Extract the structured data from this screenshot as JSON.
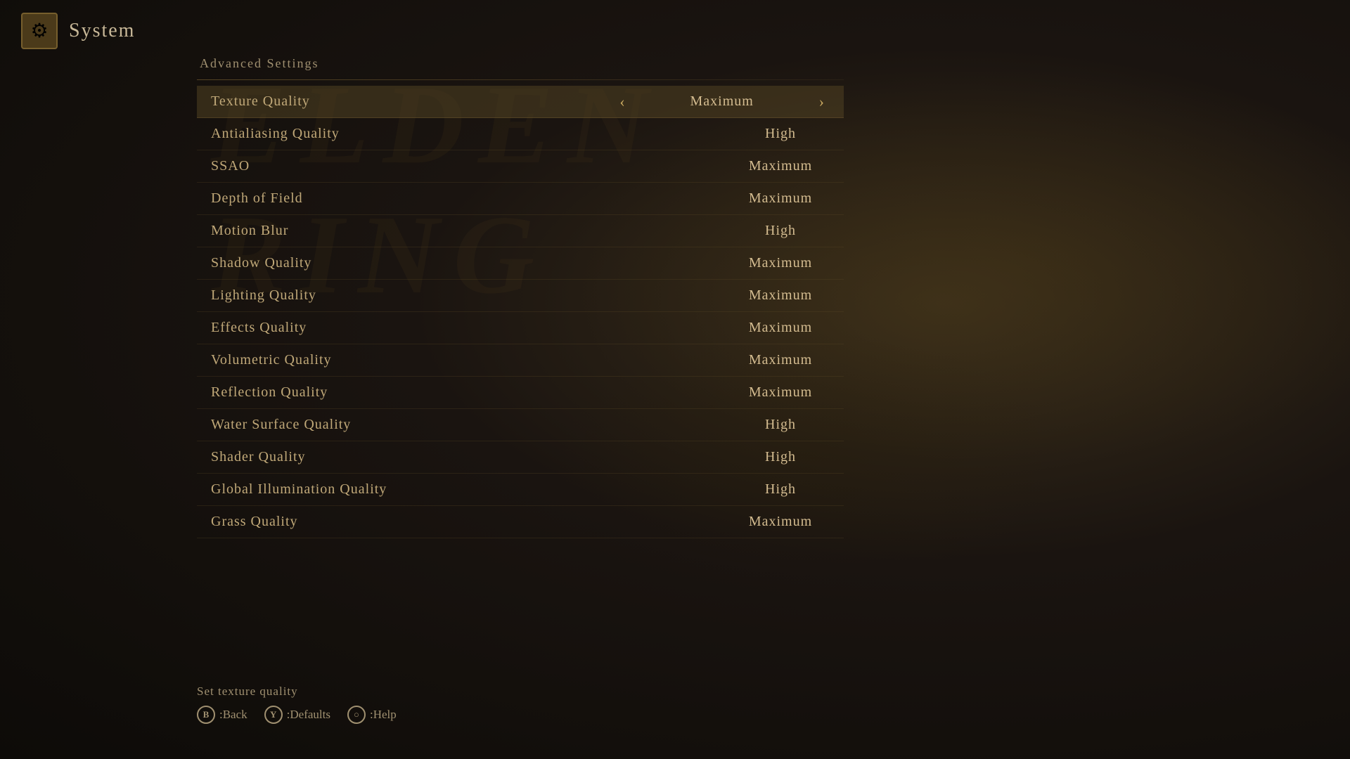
{
  "header": {
    "icon_label": "⚙",
    "title": "System"
  },
  "section": {
    "title": "Advanced Settings"
  },
  "settings": [
    {
      "label": "Texture Quality",
      "value": "Maximum",
      "active": true,
      "has_arrows": true
    },
    {
      "label": "Antialiasing Quality",
      "value": "High",
      "active": false,
      "has_arrows": false
    },
    {
      "label": "SSAO",
      "value": "Maximum",
      "active": false,
      "has_arrows": false
    },
    {
      "label": "Depth of Field",
      "value": "Maximum",
      "active": false,
      "has_arrows": false
    },
    {
      "label": "Motion Blur",
      "value": "High",
      "active": false,
      "has_arrows": false
    },
    {
      "label": "Shadow Quality",
      "value": "Maximum",
      "active": false,
      "has_arrows": false
    },
    {
      "label": "Lighting Quality",
      "value": "Maximum",
      "active": false,
      "has_arrows": false
    },
    {
      "label": "Effects Quality",
      "value": "Maximum",
      "active": false,
      "has_arrows": false
    },
    {
      "label": "Volumetric Quality",
      "value": "Maximum",
      "active": false,
      "has_arrows": false
    },
    {
      "label": "Reflection Quality",
      "value": "Maximum",
      "active": false,
      "has_arrows": false
    },
    {
      "label": "Water Surface Quality",
      "value": "High",
      "active": false,
      "has_arrows": false
    },
    {
      "label": "Shader Quality",
      "value": "High",
      "active": false,
      "has_arrows": false
    },
    {
      "label": "Global Illumination Quality",
      "value": "High",
      "active": false,
      "has_arrows": false
    },
    {
      "label": "Grass Quality",
      "value": "Maximum",
      "active": false,
      "has_arrows": false
    }
  ],
  "footer": {
    "hint": "Set texture quality",
    "controls": [
      {
        "icon": "B",
        "label": ":Back"
      },
      {
        "icon": "Y",
        "label": ":Defaults"
      },
      {
        "icon": "○",
        "label": ":Help"
      }
    ]
  }
}
